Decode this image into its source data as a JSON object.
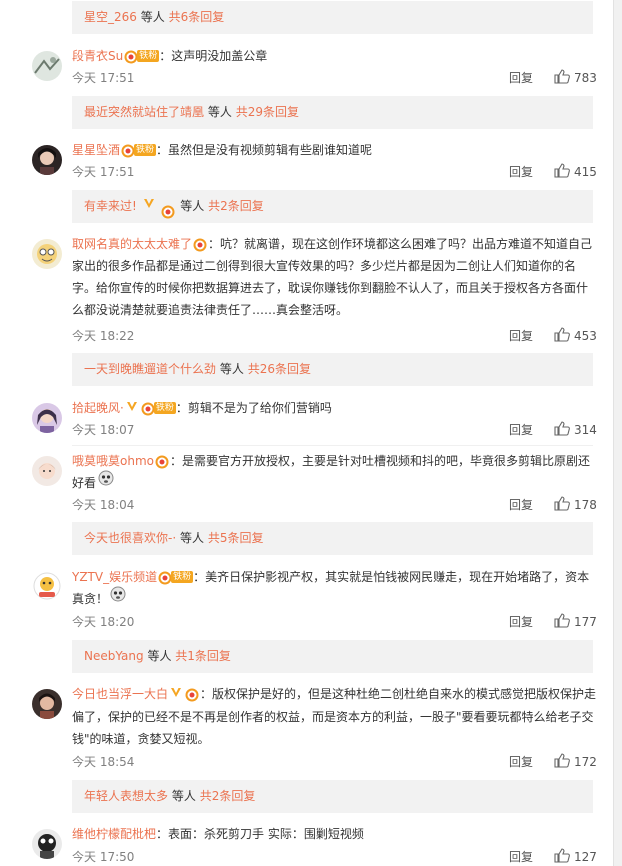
{
  "reply_label": "回复",
  "others_label": "等人",
  "reply_bars": [
    {
      "user": "星空_266",
      "count": "共6条回复"
    },
    {
      "user": "最近突然就站住了靖凰",
      "count": "共29条回复"
    },
    {
      "user": "有幸来过!",
      "count": "共2条回复"
    },
    {
      "user": "一天到晚瞧遛道个什么劲",
      "count": "共26条回复"
    },
    {
      "user": "今天也很喜欢你-·",
      "count": "共5条回复"
    },
    {
      "user": "NeebYang",
      "count": "共1条回复"
    },
    {
      "user": "年轻人表想太多",
      "count": "共2条回复"
    }
  ],
  "fan_badge": "铁粉",
  "comments": [
    {
      "user": "段青衣Su",
      "text": "：这声明没加盖公章",
      "time": "今天 17:51",
      "likes": "783"
    },
    {
      "user": "星星坠酒",
      "text": "：虽然但是没有视频剪辑有些剧谁知道呢",
      "time": "今天 17:51",
      "likes": "415"
    },
    {
      "user": "取网名真的太太太难了",
      "text": "：吭？就离谱，现在这创作环境都这么困难了吗？出品方难道不知道自己家出的很多作品都是通过二创得到很大宣传效果的吗？多少烂片都是因为二创让人们知道你的名字。给你宣传的时候你把数据算进去了，耽误你赚钱你到翻脸不认人了，而且关于授权各方各面什么都没说清楚就要追责法律责任了……真会整活呀。",
      "time": "今天 18:22",
      "likes": "453"
    },
    {
      "user": "拾起晚风·",
      "text": "：剪辑不是为了给你们营销吗",
      "time": "今天 18:07",
      "likes": "314"
    },
    {
      "user": "哦莫哦莫ohmo",
      "text": "：是需要官方开放授权，主要是针对吐槽视频和抖的吧，毕竟很多剪辑比原剧还好看",
      "time": "今天 18:04",
      "likes": "178"
    },
    {
      "user": "YZTV_娱乐频道",
      "text": "：美齐日保护影视产权，其实就是怕钱被网民赚走，现在开始堵路了，资本真贪！",
      "time": "今天 18:20",
      "likes": "177"
    },
    {
      "user": "今日也当浮一大白",
      "text": "：版权保护是好的，但是这种杜绝二创杜绝自来水的模式感觉把版权保护走偏了，保护的已经不是不再是创作者的权益，而是资本方的利益，一股子\"要看要玩都特么给老子交钱\"的味道，贪婪又短视。",
      "time": "今天 18:54",
      "likes": "172"
    },
    {
      "user": "维他柠檬配枇杷",
      "text": "：表面：杀死剪刀手 实际：围剿短视频",
      "time": "今天 17:50",
      "likes": "127"
    }
  ]
}
